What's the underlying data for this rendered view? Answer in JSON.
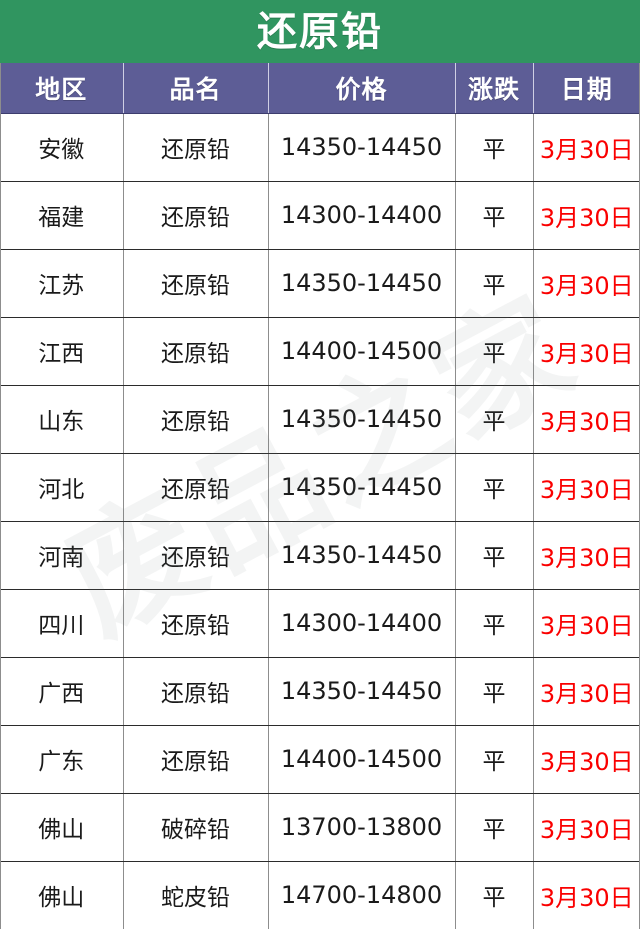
{
  "banner": {
    "title": "还原铅",
    "background_color": "#309560",
    "text_color": "#ffffff"
  },
  "watermark": {
    "text": "废品之家",
    "color": "rgba(120,125,130,0.085)"
  },
  "table": {
    "header_background_color": "#5d5d96",
    "date_text_color": "#fa0000",
    "columns": [
      {
        "key": "region",
        "label": "地区"
      },
      {
        "key": "product",
        "label": "品名"
      },
      {
        "key": "price",
        "label": "价格"
      },
      {
        "key": "change",
        "label": "涨跌"
      },
      {
        "key": "date",
        "label": "日期"
      }
    ],
    "rows": [
      {
        "region": "安徽",
        "product": "还原铅",
        "price": "14350-14450",
        "change": "平",
        "date": "3月30日"
      },
      {
        "region": "福建",
        "product": "还原铅",
        "price": "14300-14400",
        "change": "平",
        "date": "3月30日"
      },
      {
        "region": "江苏",
        "product": "还原铅",
        "price": "14350-14450",
        "change": "平",
        "date": "3月30日"
      },
      {
        "region": "江西",
        "product": "还原铅",
        "price": "14400-14500",
        "change": "平",
        "date": "3月30日"
      },
      {
        "region": "山东",
        "product": "还原铅",
        "price": "14350-14450",
        "change": "平",
        "date": "3月30日"
      },
      {
        "region": "河北",
        "product": "还原铅",
        "price": "14350-14450",
        "change": "平",
        "date": "3月30日"
      },
      {
        "region": "河南",
        "product": "还原铅",
        "price": "14350-14450",
        "change": "平",
        "date": "3月30日"
      },
      {
        "region": "四川",
        "product": "还原铅",
        "price": "14300-14400",
        "change": "平",
        "date": "3月30日"
      },
      {
        "region": "广西",
        "product": "还原铅",
        "price": "14350-14450",
        "change": "平",
        "date": "3月30日"
      },
      {
        "region": "广东",
        "product": "还原铅",
        "price": "14400-14500",
        "change": "平",
        "date": "3月30日"
      },
      {
        "region": "佛山",
        "product": "破碎铅",
        "price": "13700-13800",
        "change": "平",
        "date": "3月30日"
      },
      {
        "region": "佛山",
        "product": "蛇皮铅",
        "price": "14700-14800",
        "change": "平",
        "date": "3月30日"
      }
    ]
  }
}
